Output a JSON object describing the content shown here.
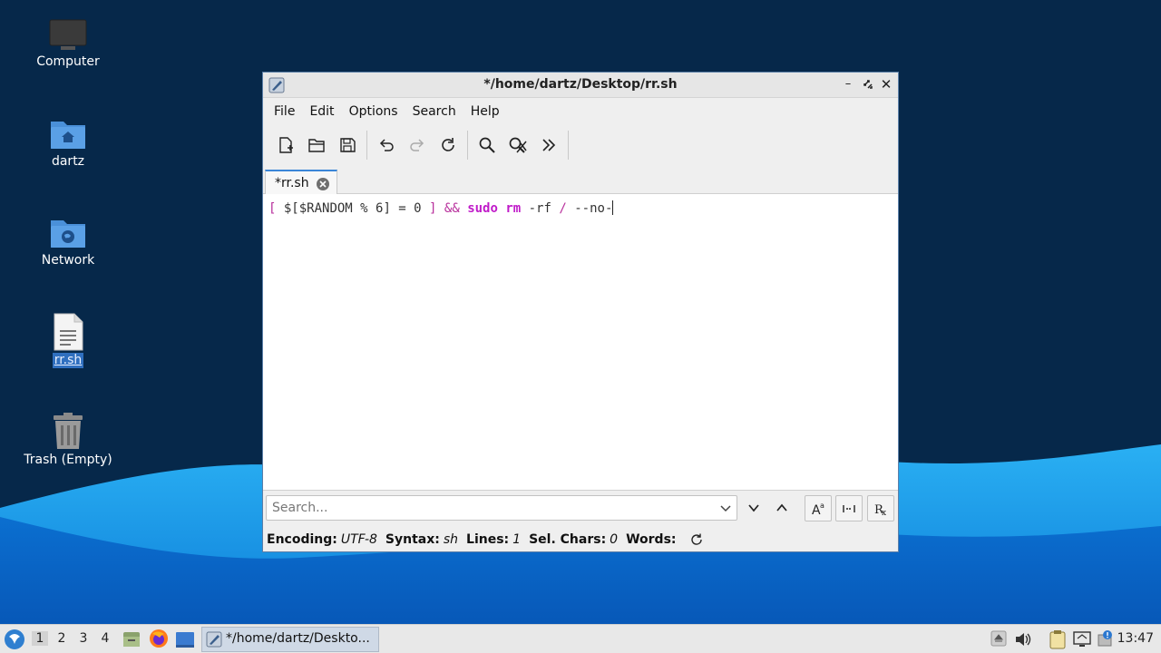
{
  "desktop": {
    "icons": [
      {
        "label": "Computer"
      },
      {
        "label": "dartz"
      },
      {
        "label": "Network"
      },
      {
        "label": "rr.sh"
      },
      {
        "label": "Trash (Empty)"
      }
    ]
  },
  "window": {
    "title": "*/home/dartz/Desktop/rr.sh",
    "menu": [
      "File",
      "Edit",
      "Options",
      "Search",
      "Help"
    ],
    "tab": "*rr.sh",
    "code": {
      "t1": "[",
      "t2": " $[$RANDOM % 6] = 0 ",
      "t3": "]",
      "t4": " ",
      "t5": "&&",
      "t6": " ",
      "t7": "sudo",
      "t8": " ",
      "t9": "rm",
      "t10": " -rf ",
      "t11": "/",
      "t12": " --no-"
    },
    "search_placeholder": "Search...",
    "status": {
      "encoding_label": "Encoding:",
      "encoding_value": "UTF-8",
      "syntax_label": "Syntax:",
      "syntax_value": "sh",
      "lines_label": "Lines:",
      "lines_value": "1",
      "selchars_label": "Sel. Chars:",
      "selchars_value": "0",
      "words_label": "Words:"
    }
  },
  "taskbar": {
    "workspaces": [
      "1",
      "2",
      "3",
      "4"
    ],
    "task_label": "*/home/dartz/Deskto...",
    "clock": "13:47"
  },
  "colors": {
    "desktop_bg": "#06284a",
    "wave_light": "#2aa7ee",
    "wave_mid": "#0b72d4",
    "keyword": "#c01bc9"
  }
}
